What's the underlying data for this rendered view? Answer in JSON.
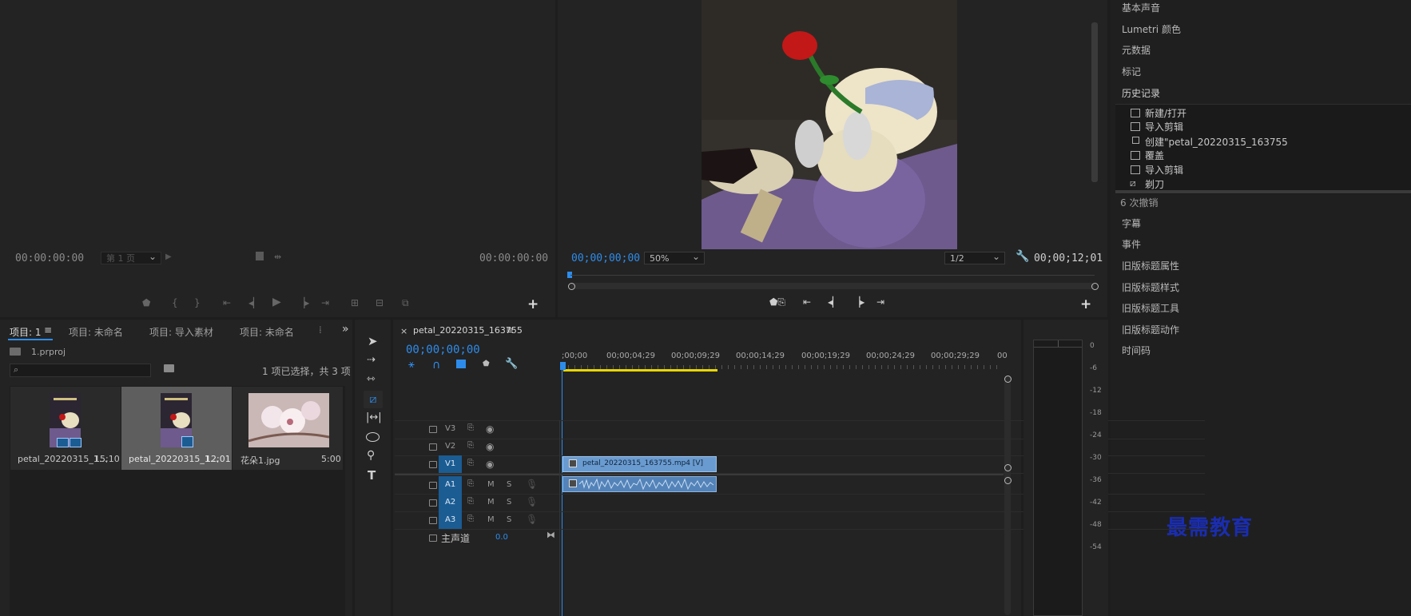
{
  "source_monitor": {
    "timecode_left": "00:00:00:00",
    "page_select": "第 1 页",
    "timecode_right": "00:00:00:00"
  },
  "program_monitor": {
    "timecode_left": "00;00;00;00",
    "zoom": "50%",
    "resolution": "1/2",
    "timecode_right": "00;00;12;01"
  },
  "project_panel": {
    "tabs": [
      "项目: 1",
      "项目: 未命名",
      "项目: 导入素材",
      "项目: 未命名"
    ],
    "project_file": "1.prproj",
    "search_placeholder": "",
    "selection_status": "1 项已选择，共 3 项",
    "items": [
      {
        "name": "petal_20220315_1...",
        "duration": "15;10"
      },
      {
        "name": "petal_20220315_1...",
        "duration": "12;01"
      },
      {
        "name": "花朵1.jpg",
        "duration": "5:00"
      }
    ]
  },
  "timeline": {
    "sequence_name": "petal_20220315_163755",
    "timecode": "00;00;00;00",
    "ruler": [
      ";00;00",
      "00;00;04;29",
      "00;00;09;29",
      "00;00;14;29",
      "00;00;19;29",
      "00;00;24;29",
      "00;00;29;29",
      "00"
    ],
    "tracks": {
      "v3": "V3",
      "v2": "V2",
      "v1": "V1",
      "a1": "A1",
      "a2": "A2",
      "a3": "A3",
      "m": "M",
      "s": "S",
      "master": "主声道",
      "master_value": "0.0"
    },
    "video_clip": "petal_20220315_163755.mp4 [V]"
  },
  "meter": {
    "scale": [
      "0",
      "-6",
      "-12",
      "-18",
      "-24",
      "-30",
      "-36",
      "-42",
      "-48",
      "-54"
    ]
  },
  "right_panel": {
    "items_top": [
      "基本声音",
      "Lumetri 颜色",
      "元数据",
      "标记",
      "历史记录"
    ],
    "history": [
      "新建/打开",
      "导入剪辑",
      "创建\"petal_20220315_163755",
      "覆盖",
      "导入剪辑",
      "剃刀"
    ],
    "undo_count": "6 次撤销",
    "items_bottom": [
      "字幕",
      "事件",
      "旧版标题属性",
      "旧版标题样式",
      "旧版标题工具",
      "旧版标题动作",
      "时间码"
    ]
  },
  "watermark": "最需教育",
  "colors": {
    "accent": "#2d8ceb",
    "clip_video": "#6a9bd0",
    "clip_audio": "#5383b8",
    "track_active": "#1b5c93",
    "work_area": "#e8d600"
  }
}
